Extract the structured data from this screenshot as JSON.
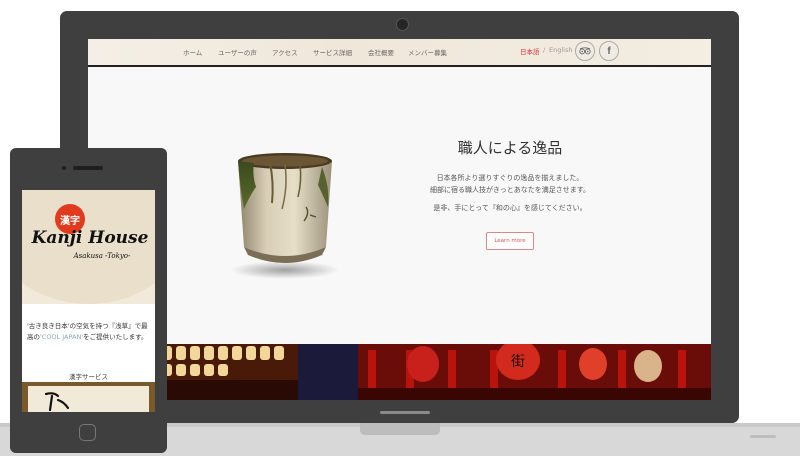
{
  "laptop_site": {
    "nav": {
      "items": [
        "ホーム",
        "ユーザーの声",
        "アクセス",
        "サービス詳細",
        "会社概要",
        "メンバー募集"
      ],
      "lang_jp": "日本語",
      "lang_sep": "/",
      "lang_en": "English",
      "icons": [
        "tripadvisor-icon",
        "facebook-icon"
      ],
      "facebook_glyph": "f"
    },
    "hero": {
      "title": "職人による逸品",
      "line1": "日本各所より選りすぐりの逸品を揃えました。",
      "line2": "細部に宿る職人技がきっとあなたを満足させます。",
      "line3": "是非、手にとって『和の心』を感じてください。",
      "button": "Learn more"
    }
  },
  "phone_site": {
    "logo": {
      "seal": "漢字",
      "name": "Kanji House",
      "sub": "Asakusa -Tokyo-"
    },
    "intro_part1": "'古き良き日本'の空気を持つ『浅草』で最高の",
    "intro_highlight": "'COOL JAPAN'",
    "intro_part2": "をご提供いたします。",
    "section_title": "漢字サービス"
  },
  "colors": {
    "device": "#3f3f3f",
    "accent_red": "#d43030",
    "nav_bg": "#f1ebe0"
  }
}
